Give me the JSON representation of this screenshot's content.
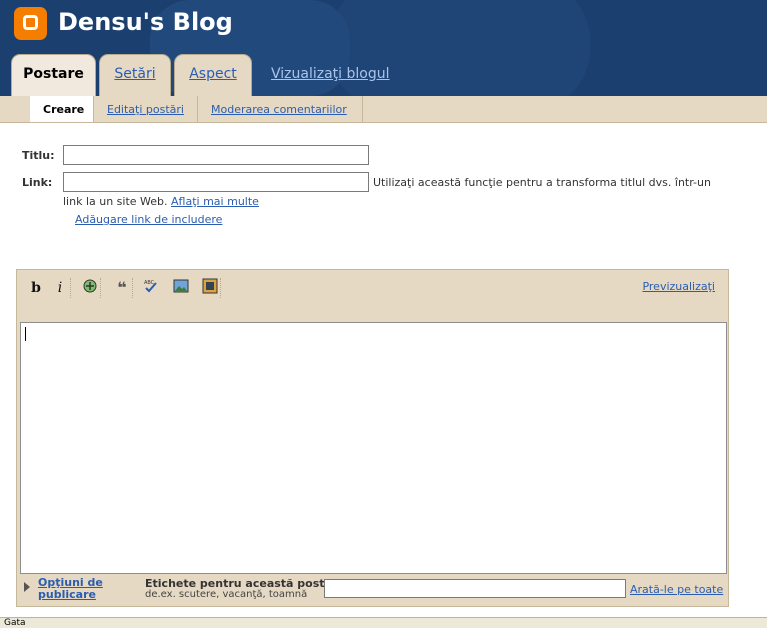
{
  "header": {
    "blog_title": "Densu's Blog",
    "tabs": [
      {
        "label": "Postare"
      },
      {
        "label": "Setări"
      },
      {
        "label": "Aspect"
      }
    ],
    "view_blog": "Vizualizaţi blogul"
  },
  "subnav": {
    "items": [
      {
        "label": "Creare"
      },
      {
        "label": "Editaţi postări"
      },
      {
        "label": "Moderarea comentariilor"
      }
    ]
  },
  "form": {
    "title_label": "Titlu:",
    "title_value": "",
    "link_label": "Link:",
    "link_value": "",
    "hint_text": "Utilizaţi această funcţie pentru a transforma titlul dvs. într-un",
    "hint_line2": "link la un site Web.",
    "learn_more": "Aflaţi mai multe",
    "add_enclosure": "Adăugare link de includere"
  },
  "editor": {
    "toolbar": {
      "bold": "b",
      "italic": "i",
      "link": "link-icon",
      "quote": "quote-icon",
      "spellcheck": "spellcheck-icon",
      "image": "image-icon",
      "video": "video-icon"
    },
    "preview": "Previzualizaţi",
    "body_value": "",
    "options_link": "Opţiuni de publicare",
    "labels_caption": "Etichete pentru această postare:",
    "labels_example": "de.ex. scutere, vacanţă, toamnă",
    "labels_value": "",
    "show_all": "Arată-le pe toate"
  },
  "status": {
    "text": "Gata"
  },
  "colors": {
    "header_bg": "#1b3f6e",
    "tab_bg": "#e6d9c3",
    "link": "#2a5db0",
    "blogger_orange": "#f57d00"
  }
}
